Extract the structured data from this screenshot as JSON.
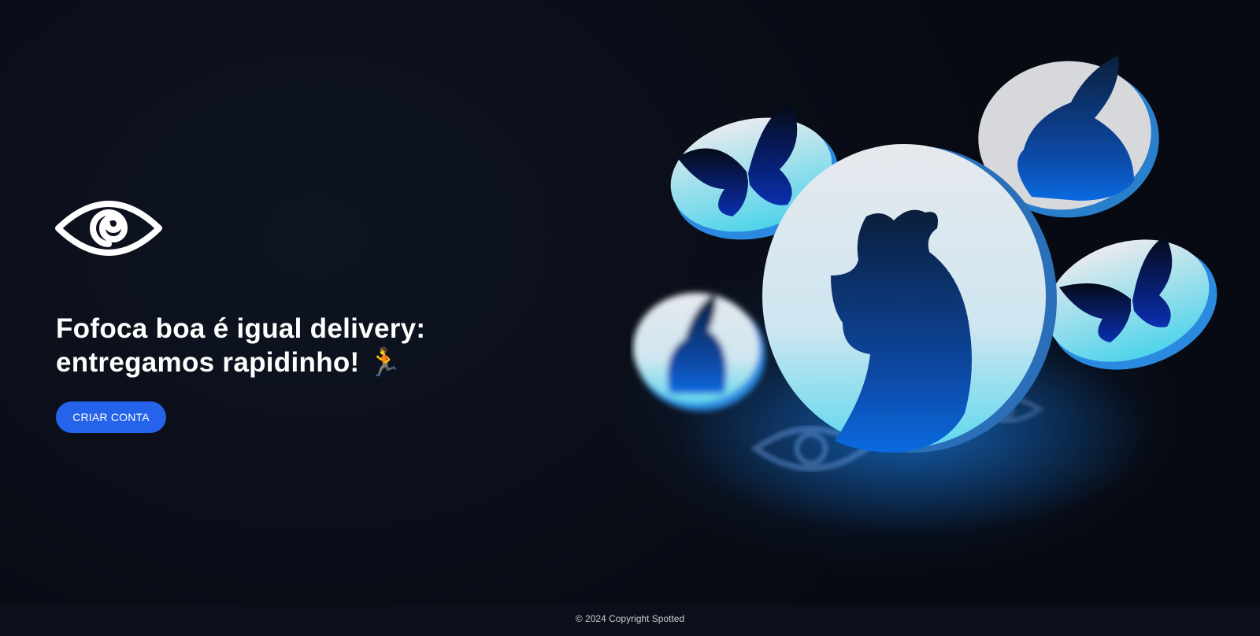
{
  "brand": {
    "logo_icon": "eye-icon"
  },
  "hero": {
    "headline_line1": "Fofoca boa é igual delivery:",
    "headline_line2": "entregamos rapidinho! 🏃",
    "cta_label": "CRIAR CONTA",
    "illustration": {
      "description_icons": [
        "rooster-icon",
        "rabbit-icon",
        "butterfly-icon",
        "eye-icon"
      ]
    }
  },
  "footer": {
    "copyright": "© 2024 Copyright Spotted"
  },
  "colors": {
    "background": "#0a0d17",
    "accent": "#2563eb",
    "text": "#ffffff",
    "footer_text": "#c9ccd4"
  }
}
